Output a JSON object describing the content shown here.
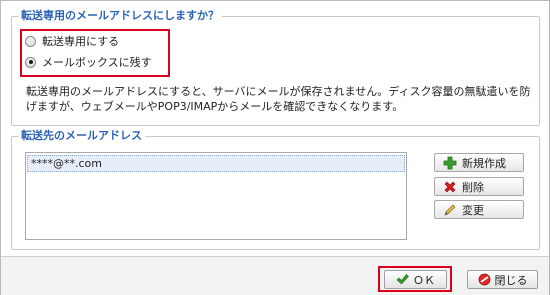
{
  "forward_mode": {
    "legend": "転送専用のメールアドレスにしますか？",
    "options": [
      {
        "label": "転送専用にする",
        "selected": false
      },
      {
        "label": "メールボックスに残す",
        "selected": true
      }
    ],
    "description": "転送専用のメールアドレスにすると、サーバにメールが保存されません。ディスク容量の無駄遣いを防げますが、ウェブメールやPOP3/IMAPからメールを確認できなくなります。"
  },
  "forward_targets": {
    "legend": "転送先のメールアドレス",
    "items": [
      "****@**.com"
    ],
    "buttons": {
      "new": "新規作成",
      "delete": "削除",
      "edit": "変更"
    }
  },
  "footer": {
    "ok": "ＯＫ",
    "close": "閉じる"
  },
  "colors": {
    "legend": "#2b63b4",
    "highlight_border": "#d8001d"
  }
}
